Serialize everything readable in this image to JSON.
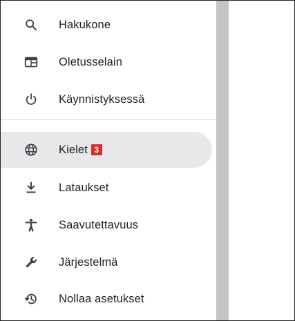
{
  "sidebar": {
    "items": [
      {
        "label": "Hakukone",
        "icon": "search-icon"
      },
      {
        "label": "Oletusselain",
        "icon": "browser-window-icon"
      },
      {
        "label": "Käynnistyksessä",
        "icon": "power-icon"
      },
      {
        "label": "Kielet",
        "icon": "globe-icon",
        "badge": "3",
        "active": true
      },
      {
        "label": "Lataukset",
        "icon": "download-icon"
      },
      {
        "label": "Saavutettavuus",
        "icon": "accessibility-icon"
      },
      {
        "label": "Järjestelmä",
        "icon": "wrench-icon"
      },
      {
        "label": "Nollaa asetukset",
        "icon": "reset-history-icon"
      }
    ]
  },
  "colors": {
    "active_bg": "#e8e8ea",
    "badge_bg": "#d32f2f",
    "scrollbar": "#c4c4c4"
  }
}
